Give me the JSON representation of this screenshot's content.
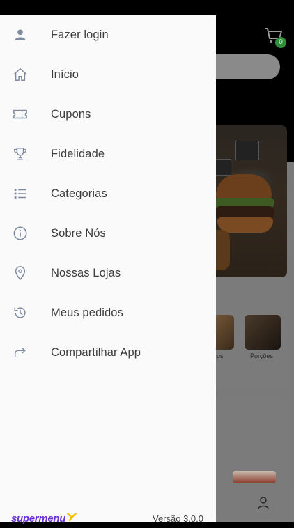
{
  "background": {
    "cart_count": "0",
    "categories": [
      {
        "label": "scos"
      },
      {
        "label": "Porções"
      }
    ]
  },
  "drawer": {
    "items": [
      {
        "label": "Fazer login",
        "icon": "user-icon"
      },
      {
        "label": "Início",
        "icon": "home-icon"
      },
      {
        "label": "Cupons",
        "icon": "ticket-icon"
      },
      {
        "label": "Fidelidade",
        "icon": "trophy-icon"
      },
      {
        "label": "Categorias",
        "icon": "list-icon"
      },
      {
        "label": "Sobre Nós",
        "icon": "info-icon"
      },
      {
        "label": "Nossas Lojas",
        "icon": "location-pin-icon"
      },
      {
        "label": "Meus pedidos",
        "icon": "history-icon"
      },
      {
        "label": "Compartilhar App",
        "icon": "share-icon"
      }
    ],
    "footer": {
      "logo_text": "supermenu",
      "version": "Versão 3.0.0"
    }
  },
  "colors": {
    "brand": "#6b2fd6",
    "brand_mark": "#f2c200",
    "badge": "#2f8f3a"
  }
}
